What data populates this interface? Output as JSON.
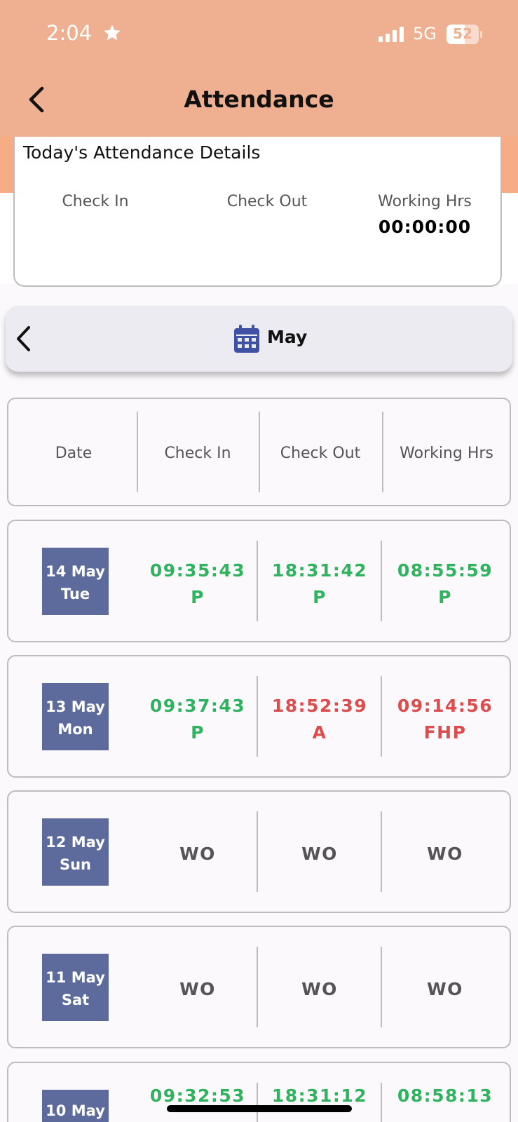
{
  "status": {
    "time": "2:04",
    "network": "5G",
    "battery": "52"
  },
  "nav": {
    "title": "Attendance"
  },
  "today": {
    "title": "Today's Attendance Details",
    "check_in_label": "Check In",
    "check_out_label": "Check Out",
    "working_hrs_label": "Working Hrs",
    "working_hrs_value": "00:00:00"
  },
  "month": {
    "label": "May"
  },
  "table": {
    "headers": [
      "Date",
      "Check In",
      "Check Out",
      "Working Hrs"
    ],
    "rows": [
      {
        "date": "14 May",
        "day": "Tue",
        "in_time": "09:35:43",
        "in_status": "P",
        "out_time": "18:31:42",
        "out_status": "P",
        "hrs": "08:55:59",
        "hrs_status": "P"
      },
      {
        "date": "13 May",
        "day": "Mon",
        "in_time": "09:37:43",
        "in_status": "P",
        "out_time": "18:52:39",
        "out_status": "A",
        "hrs": "09:14:56",
        "hrs_status": "FHP"
      },
      {
        "date": "12 May",
        "day": "Sun",
        "in_time": "WO",
        "out_time": "WO",
        "hrs": "WO"
      },
      {
        "date": "11 May",
        "day": "Sat",
        "in_time": "WO",
        "out_time": "WO",
        "hrs": "WO"
      },
      {
        "date": "10 May",
        "in_time": "09:32:53",
        "out_time": "18:31:12",
        "hrs": "08:58:13"
      }
    ]
  },
  "colors": {
    "header": "#efaf91",
    "present": "#2fb35e",
    "absent": "#de4d4d",
    "date_box": "#5c6b9b"
  }
}
